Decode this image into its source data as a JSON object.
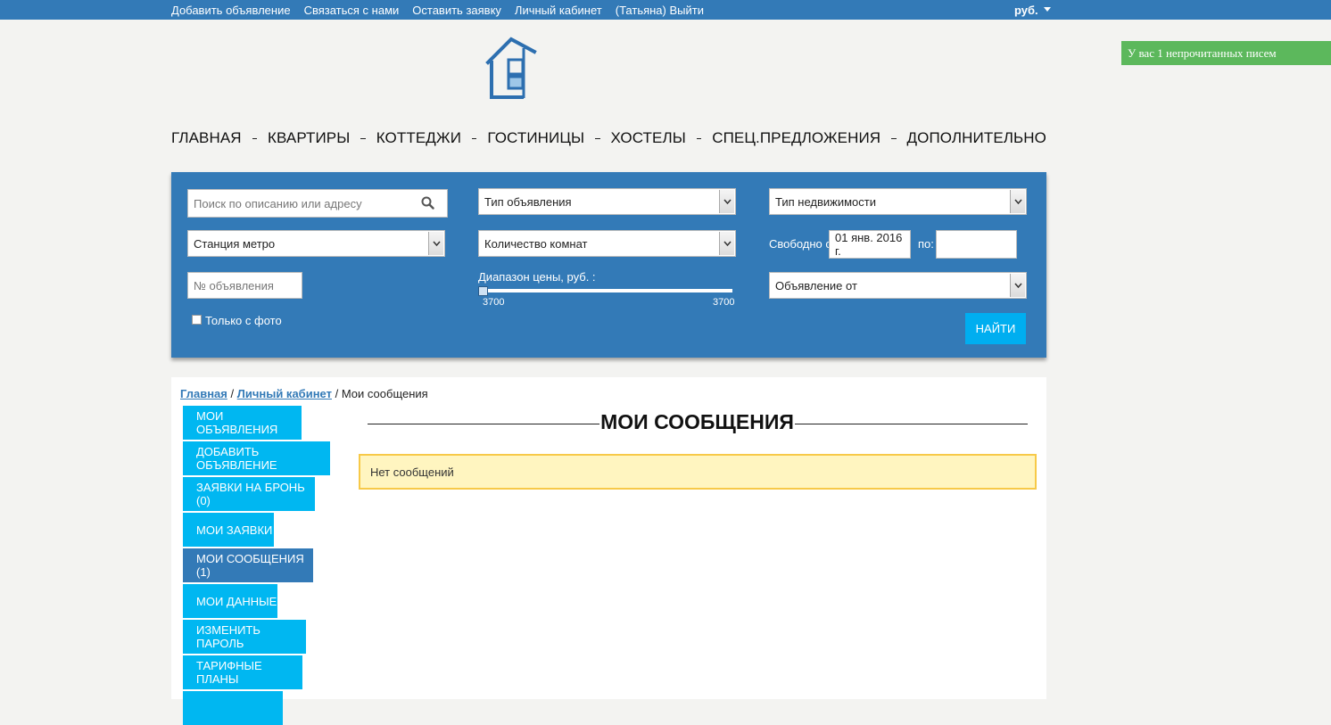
{
  "topbar": {
    "links": [
      "Добавить объявление",
      "Связаться с нами",
      "Оставить заявку",
      "Личный кабинет",
      "(Татьяна) Выйти"
    ],
    "currency": "руб."
  },
  "notification": "У вас 1 непрочитанных писем",
  "nav": [
    "ГЛАВНАЯ",
    "КВАРТИРЫ",
    "КОТТЕДЖИ",
    "ГОСТИНИЦЫ",
    "ХОСТЕЛЫ",
    "СПЕЦ.ПРЕДЛОЖЕНИЯ",
    "ДОПОЛНИТЕЛЬНО"
  ],
  "search": {
    "text_placeholder": "Поиск по описанию или адресу",
    "ad_type": "Тип объявления",
    "property_type": "Тип недвижимости",
    "metro": "Станция метро",
    "rooms": "Количество комнат",
    "free_from_label": "Свободно с:",
    "free_from_value": "01 янв. 2016 г.",
    "free_to_label": "по:",
    "free_to_value": "",
    "ad_number_placeholder": "№ объявления",
    "price_range_label": "Диапазон цены, руб. :",
    "price_min": "3700",
    "price_max": "3700",
    "ad_from": "Объявление от",
    "photo_only_label": "Только с фото",
    "photo_only_checked": false,
    "find_button": "НАЙТИ"
  },
  "breadcrumb": {
    "home": "Главная",
    "sep1": " / ",
    "cabinet": "Личный кабинет",
    "sep2": " / ",
    "current": "Мои сообщения"
  },
  "sidemenu": [
    "МОИ ОБЪЯВЛЕНИЯ",
    "ДОБАВИТЬ ОБЪЯВЛЕНИЕ",
    "ЗАЯВКИ НА БРОНЬ (0)",
    "МОИ ЗАЯВКИ",
    "МОИ СООБЩЕНИЯ (1)",
    "МОИ ДАННЫЕ",
    "ИЗМЕНИТЬ ПАРОЛЬ",
    "ТАРИФНЫЕ ПЛАНЫ"
  ],
  "sidemenu_active": "МОИ СООБЩЕНИЯ (1)",
  "page_title": "МОИ СООБЩЕНИЯ",
  "alert": "Нет сообщений",
  "colors": {
    "primary": "#337ab7",
    "accent": "#00b7f1",
    "notice": "#5cb85c",
    "alert_bg": "#fff5c0",
    "alert_border": "#f7c948"
  }
}
